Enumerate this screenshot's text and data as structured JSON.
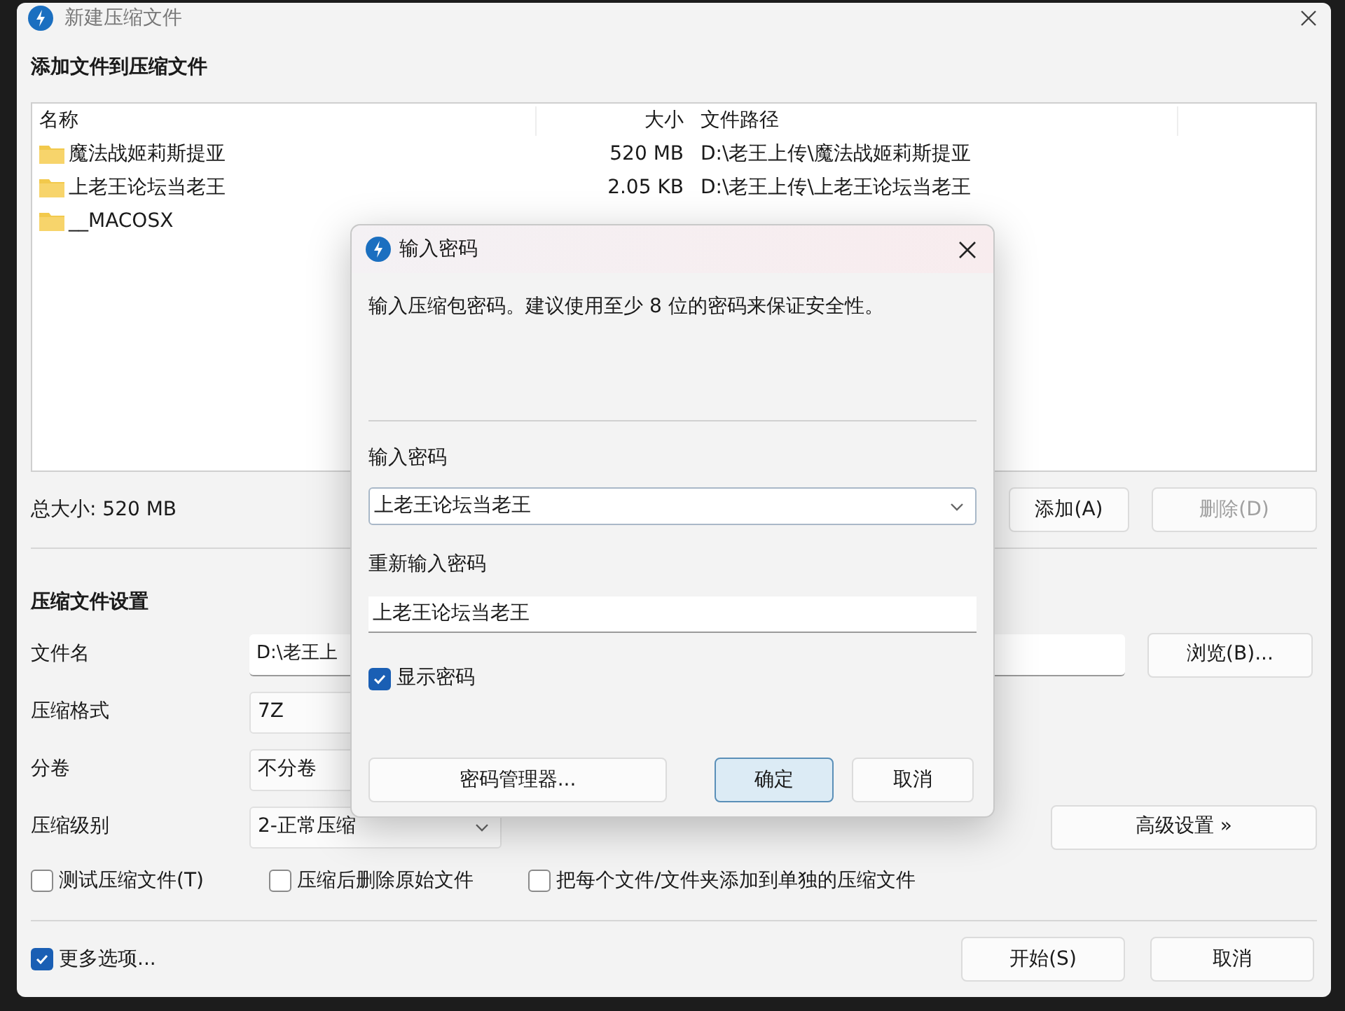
{
  "window": {
    "title": "新建压缩文件"
  },
  "files_section": {
    "heading": "添加文件到压缩文件",
    "columns": [
      "名称",
      "大小",
      "文件路径"
    ],
    "rows": [
      {
        "name": "魔法战姬莉斯提亚",
        "size": "520 MB",
        "path": "D:\\老王上传\\魔法战姬莉斯提亚"
      },
      {
        "name": "上老王论坛当老王",
        "size": "2.05 KB",
        "path": "D:\\老王上传\\上老王论坛当老王"
      },
      {
        "name": "__MACOSX"
      }
    ],
    "total": "总大小: 520 MB",
    "buttons": [
      {
        "label": "添加(A)",
        "disabled": false
      },
      {
        "label": "删除(D)",
        "disabled": true
      }
    ]
  },
  "settings": {
    "heading": "压缩文件设置",
    "fields": [
      {
        "label": "文件名",
        "value": "D:\\老王上",
        "kind": "text"
      },
      {
        "label": "压缩格式",
        "value": "7Z",
        "kind": "combo"
      },
      {
        "label": "分卷",
        "value": "不分卷",
        "kind": "combo"
      },
      {
        "label": "压缩级别",
        "value": "2-正常压缩",
        "kind": "select"
      }
    ],
    "browse_button": "浏览(B)...",
    "advanced_button": "高级设置 »",
    "options": [
      {
        "label": "测试压缩文件(T)",
        "checked": false
      },
      {
        "label": "压缩后删除原始文件",
        "checked": false
      },
      {
        "label": "把每个文件/文件夹添加到单独的压缩文件",
        "checked": false
      }
    ]
  },
  "more_options": {
    "label": "更多选项...",
    "checked": true
  },
  "footer_buttons": [
    "开始(S)",
    "取消"
  ],
  "password_dialog": {
    "title": "输入密码",
    "message": "输入压缩包密码。建议使用至少 8 位的密码来保证安全性。",
    "password_label": "输入密码",
    "password_value": "上老王论坛当老王",
    "confirm_label": "重新输入密码",
    "confirm_value": "上老王论坛当老王",
    "show_password": {
      "label": "显示密码",
      "checked": true
    },
    "buttons": [
      {
        "label": "密码管理器...",
        "default": false
      },
      {
        "label": "确定",
        "default": true
      },
      {
        "label": "取消",
        "default": false
      }
    ]
  }
}
